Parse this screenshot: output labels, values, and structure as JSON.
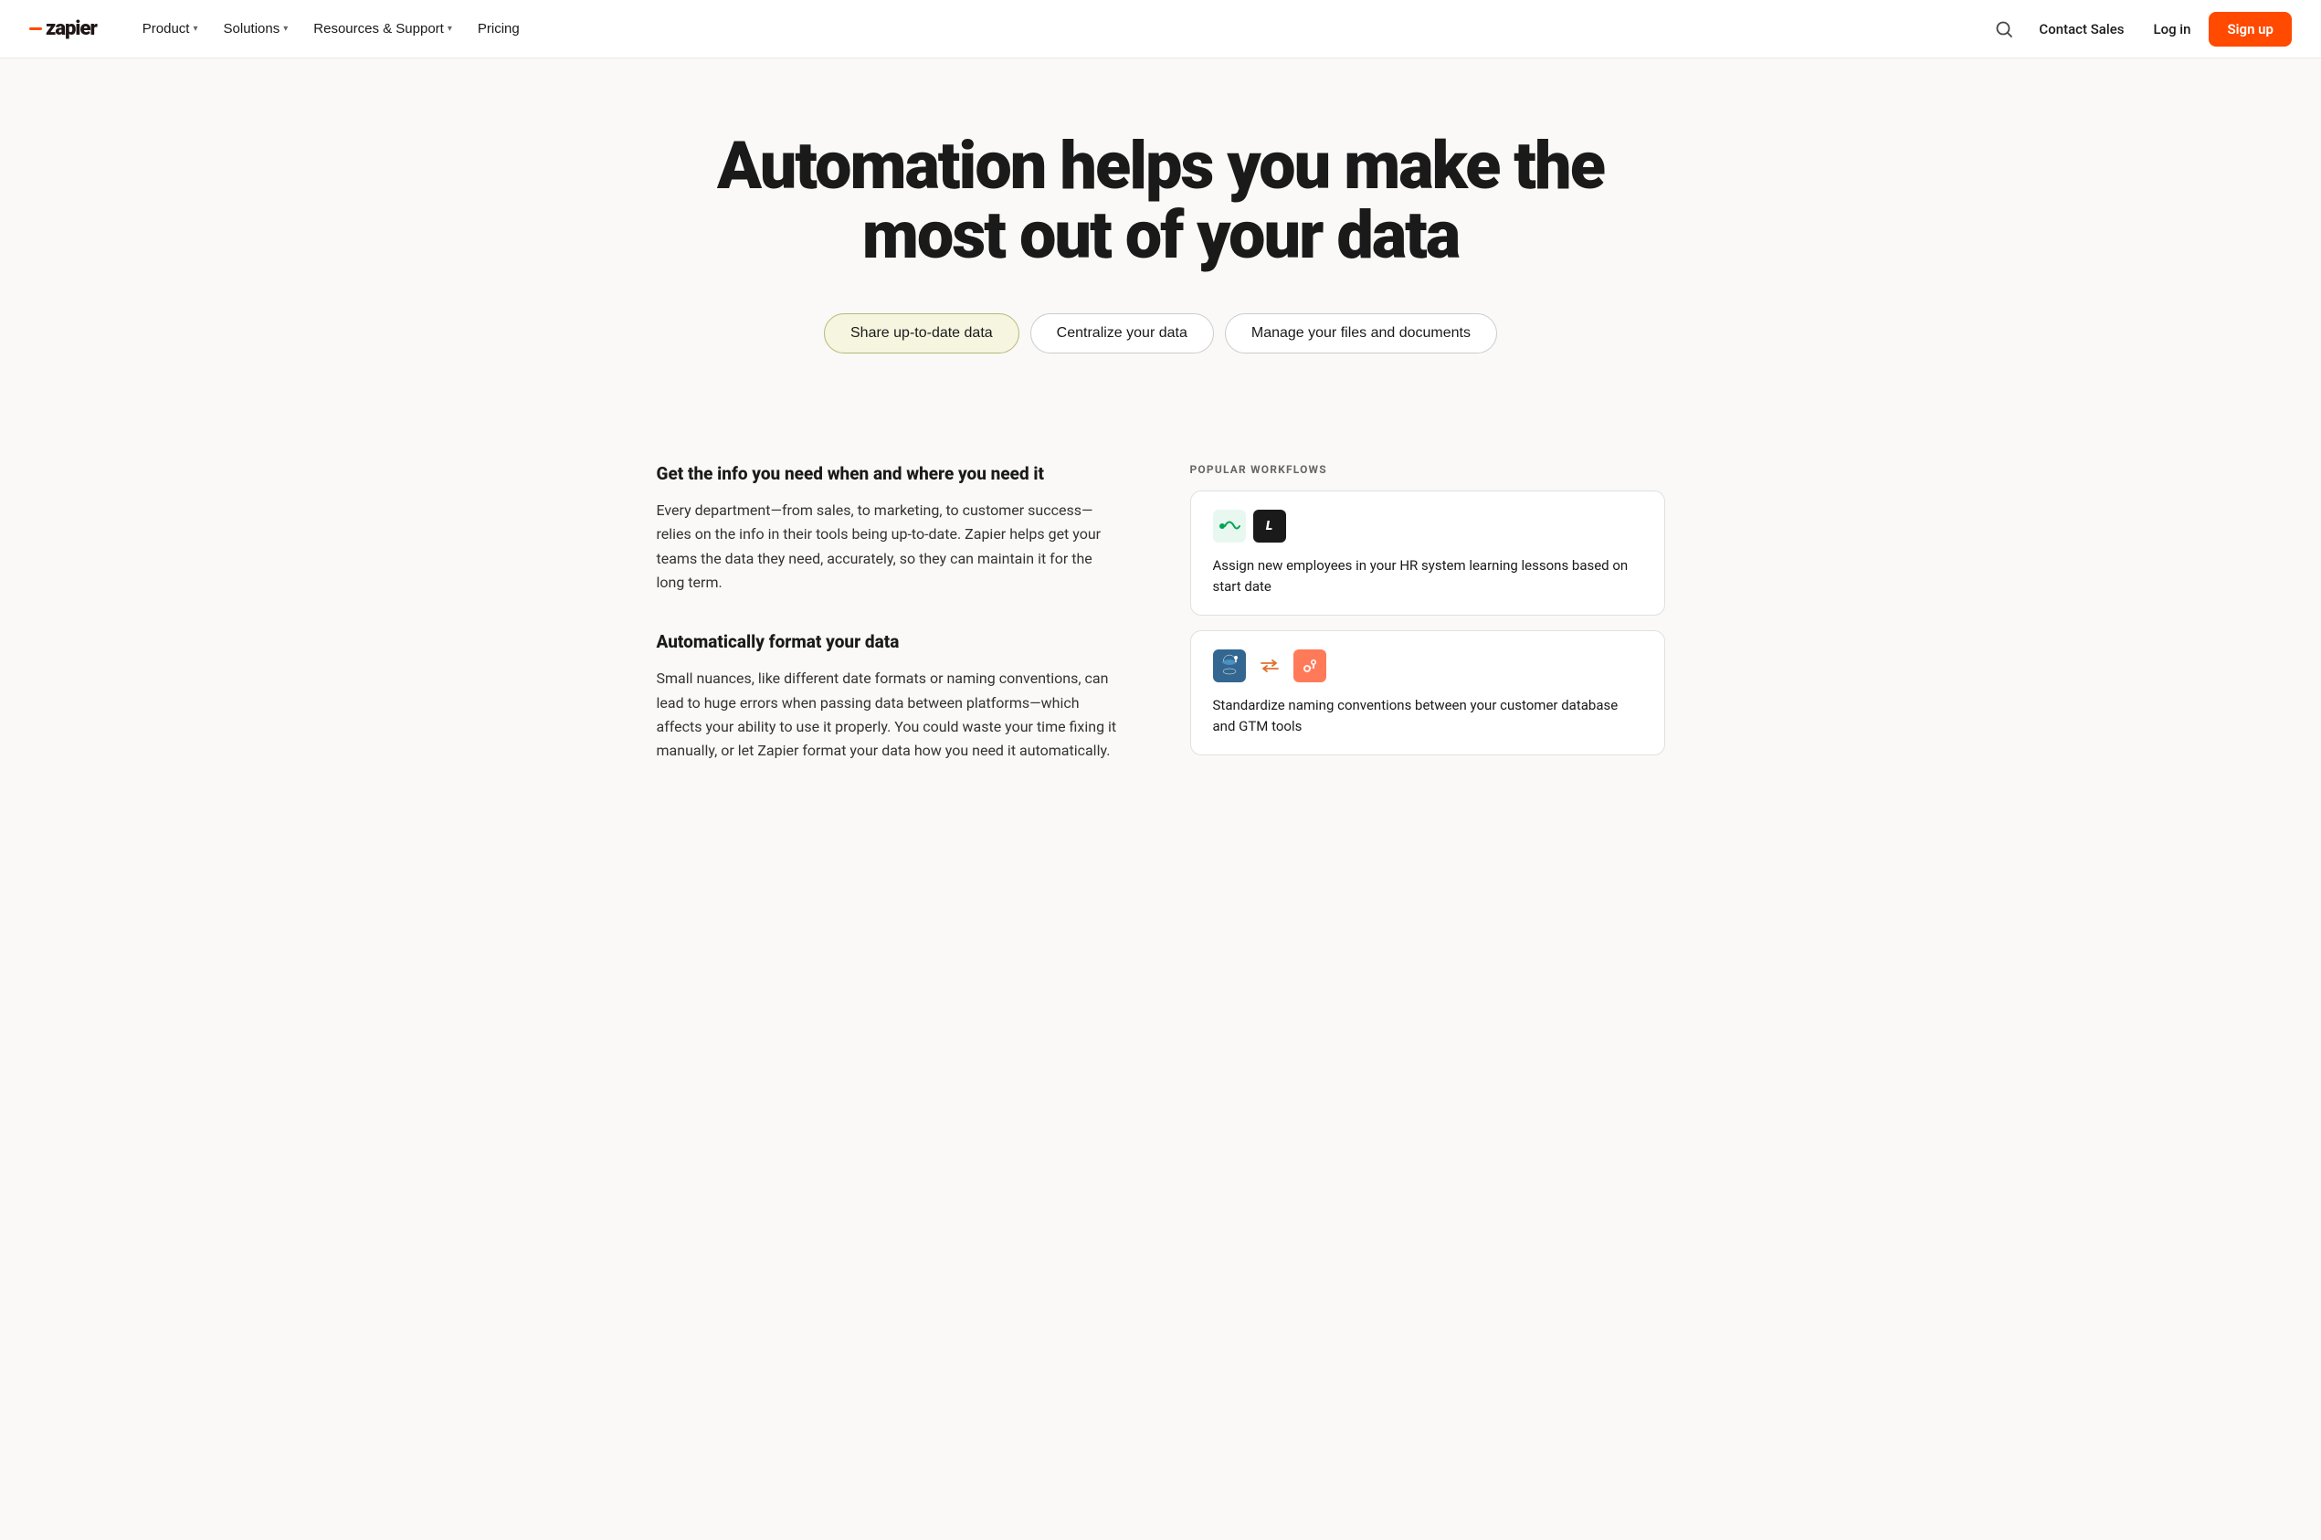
{
  "nav": {
    "logo_text": "zapier",
    "links": [
      {
        "label": "Product",
        "has_dropdown": true
      },
      {
        "label": "Solutions",
        "has_dropdown": true
      },
      {
        "label": "Resources & Support",
        "has_dropdown": true
      },
      {
        "label": "Pricing",
        "has_dropdown": false
      }
    ],
    "contact_sales": "Contact Sales",
    "login": "Log in",
    "signup": "Sign up"
  },
  "hero": {
    "title": "Automation helps you make the most out of your data"
  },
  "tabs": [
    {
      "label": "Share up-to-date data",
      "active": true
    },
    {
      "label": "Centralize your data",
      "active": false
    },
    {
      "label": "Manage your files and documents",
      "active": false
    }
  ],
  "sections": [
    {
      "heading": "Get the info you need when and where you need it",
      "body": "Every department—from sales, to marketing, to customer success—relies on the info in their tools being up-to-date. Zapier helps get your teams the data they need, accurately, so they can maintain it for the long term."
    },
    {
      "heading": "Automatically format your data",
      "body": "Small nuances, like different date formats or naming conventions, can lead to huge errors when passing data between platforms—which affects your ability to use it properly. You could waste your time fixing it manually, or let Zapier format your data how you need it automatically."
    }
  ],
  "workflows": {
    "label": "POPULAR WORKFLOWS",
    "cards": [
      {
        "icons": [
          "bounce",
          "litmos"
        ],
        "description": "Assign new employees in your HR system learning lessons based on start date"
      },
      {
        "icons": [
          "postgres",
          "arrow",
          "hubspot"
        ],
        "description": "Standardize naming conventions between your customer database and GTM tools"
      }
    ]
  }
}
